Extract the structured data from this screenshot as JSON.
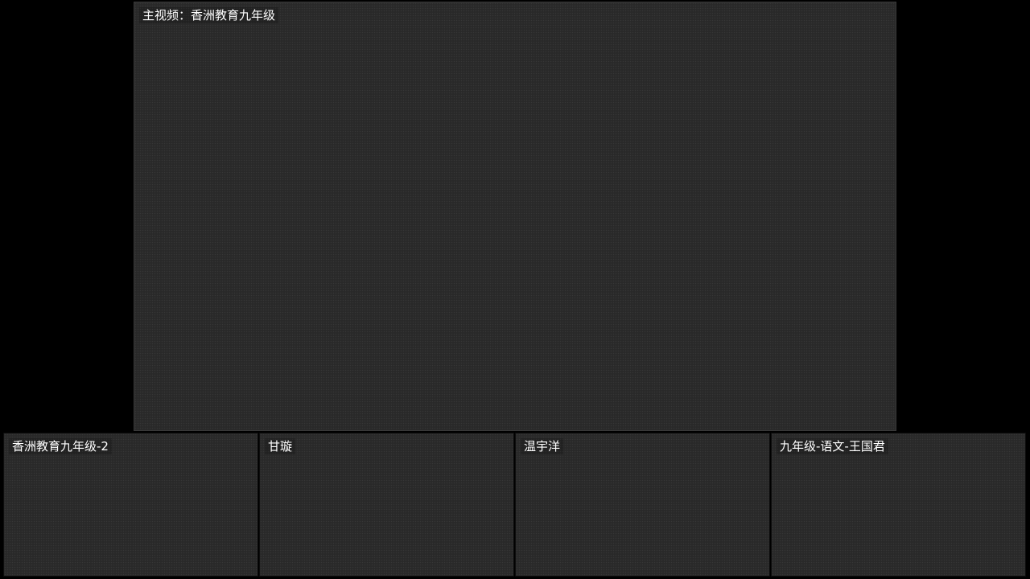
{
  "main_video": {
    "label": "主视频：香洲教育九年级"
  },
  "participants": [
    {
      "label": "香洲教育九年级-2"
    },
    {
      "label": "甘璇"
    },
    {
      "label": "温宇洋"
    },
    {
      "label": "九年级-语文-王国君"
    }
  ],
  "colors": {
    "background": "#000000",
    "tile": "#2b2b2b",
    "label_text": "#ffffff"
  }
}
